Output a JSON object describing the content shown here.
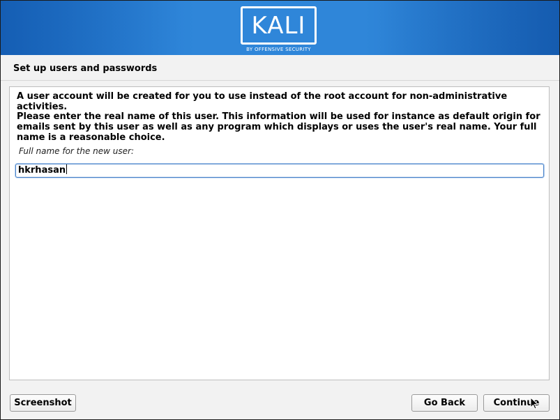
{
  "header": {
    "logo_text": "KALI",
    "logo_subtitle": "BY OFFENSIVE SECURITY"
  },
  "page": {
    "title": "Set up users and passwords"
  },
  "content": {
    "paragraph1": "A user account will be created for you to use instead of the root account for non-administrative activities.",
    "paragraph2": "Please enter the real name of this user. This information will be used for instance as default origin for emails sent by this user as well as any program which displays or uses the user's real name. Your full name is a reasonable choice.",
    "field_label": "Full name for the new user:",
    "field_value": "hkrhasan"
  },
  "buttons": {
    "screenshot": "Screenshot",
    "back": "Go Back",
    "continue": "Continue"
  },
  "colors": {
    "banner": "#2f86d9",
    "input_focus_border": "#4a83c9"
  }
}
